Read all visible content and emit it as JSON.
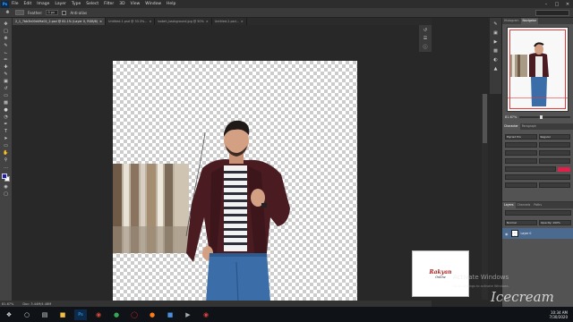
{
  "menubar": {
    "items": [
      "File",
      "Edit",
      "Image",
      "Layer",
      "Type",
      "Select",
      "Filter",
      "3D",
      "View",
      "Window",
      "Help"
    ]
  },
  "optionsbar": {
    "feather_label": "Feather:",
    "feather_value": "0 px",
    "antialias_label": "Anti-alias"
  },
  "tabs": [
    "2_1_7bb3b00d49a02_2.psd @ 81.1% (Layer 0, RGB/8)",
    "Untitled-1.psd @ 33.3%...",
    "bokeh_background.jpg @ 50%",
    "Untitled-2.psd..."
  ],
  "status": {
    "zoom": "81.67%",
    "doc": "Doc: 3.44M/4.48M"
  },
  "panels": {
    "navigator_tabs": [
      "Histogram",
      "Navigator"
    ],
    "zoom_value": "81.67%",
    "character_tabs": [
      "Character",
      "Paragraph"
    ],
    "font_family": "Myriad Pro",
    "font_style": "Regular",
    "layers_tabs": [
      "Layers",
      "Channels",
      "Paths"
    ],
    "layer_name": "Layer 0",
    "blend_mode": "Normal",
    "opacity": "Opacity: 100%"
  },
  "watermark": {
    "logo_line1": "Rakyan",
    "logo_line2": "Online",
    "activate_title": "Activate Windows",
    "activate_sub": "Go to Settings to activate Windows.",
    "recorder": "Icecream"
  },
  "taskbar": {
    "time": "10:34 AM",
    "date": "7/30/2020"
  },
  "colors": {
    "foreground": "#1d1db8",
    "background": "#ffffff",
    "accent": "#31a8ff",
    "jacket": "#4a1c22",
    "jeans": "#3b6ea8"
  }
}
